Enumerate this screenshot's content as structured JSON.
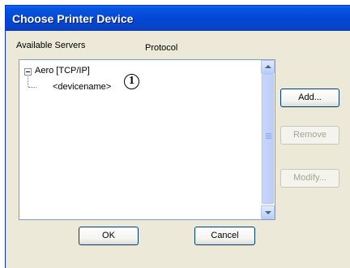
{
  "window": {
    "title": "Choose Printer Device"
  },
  "headers": {
    "available_servers": "Available Servers",
    "protocol": "Protocol"
  },
  "tree": {
    "server": "Aero  [TCP/IP]",
    "device": "<devicename>",
    "callout": "1"
  },
  "buttons": {
    "add": "Add...",
    "remove": "Remove",
    "modify": "Modify...",
    "ok": "OK",
    "cancel": "Cancel"
  },
  "colors": {
    "titlebar": "#0346d6",
    "dialog_bg": "#ece9d8",
    "disabled_text": "#a6a592"
  },
  "icons": [
    "tree-collapse-icon",
    "scroll-up-icon",
    "scroll-down-icon"
  ]
}
